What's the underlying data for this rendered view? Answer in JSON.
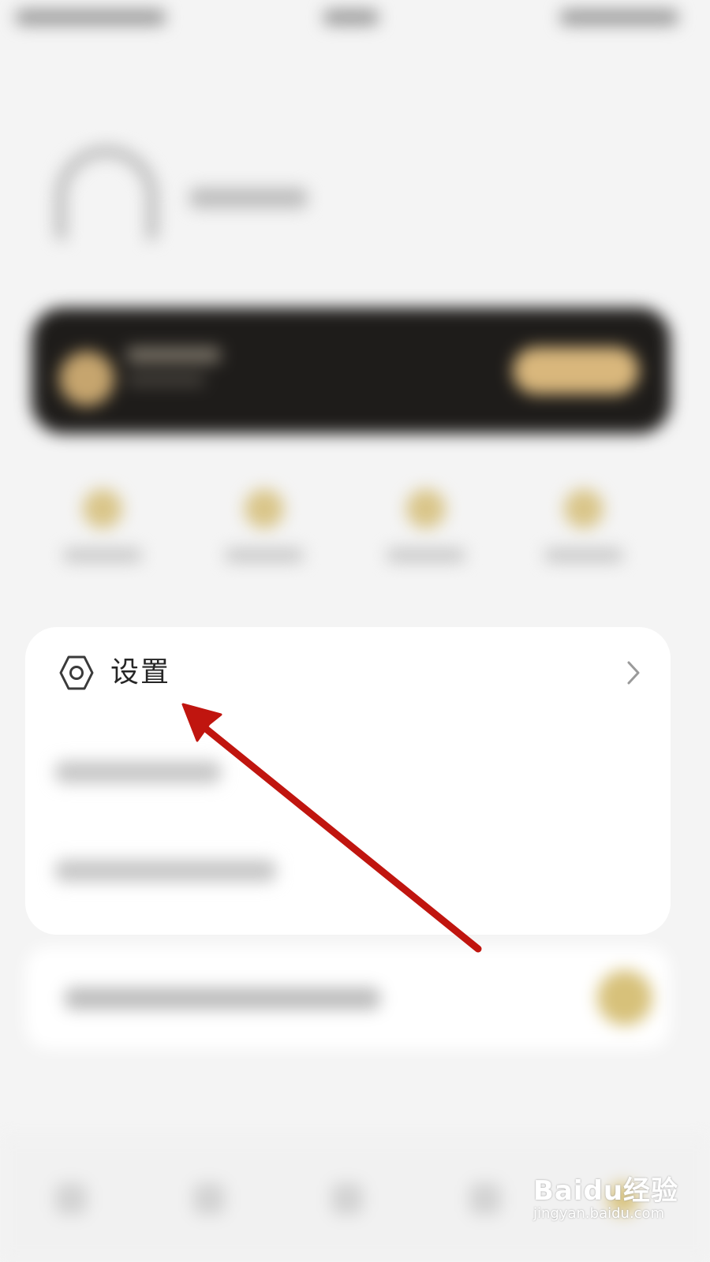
{
  "settings": {
    "label": "设置",
    "icon": "hexagon-gear-icon",
    "chevron_icon": "chevron-right-icon"
  },
  "annotation": {
    "arrow_color": "#c0150f"
  },
  "watermark": {
    "brand": "Baidu经验",
    "url": "jingyan.baidu.com"
  }
}
